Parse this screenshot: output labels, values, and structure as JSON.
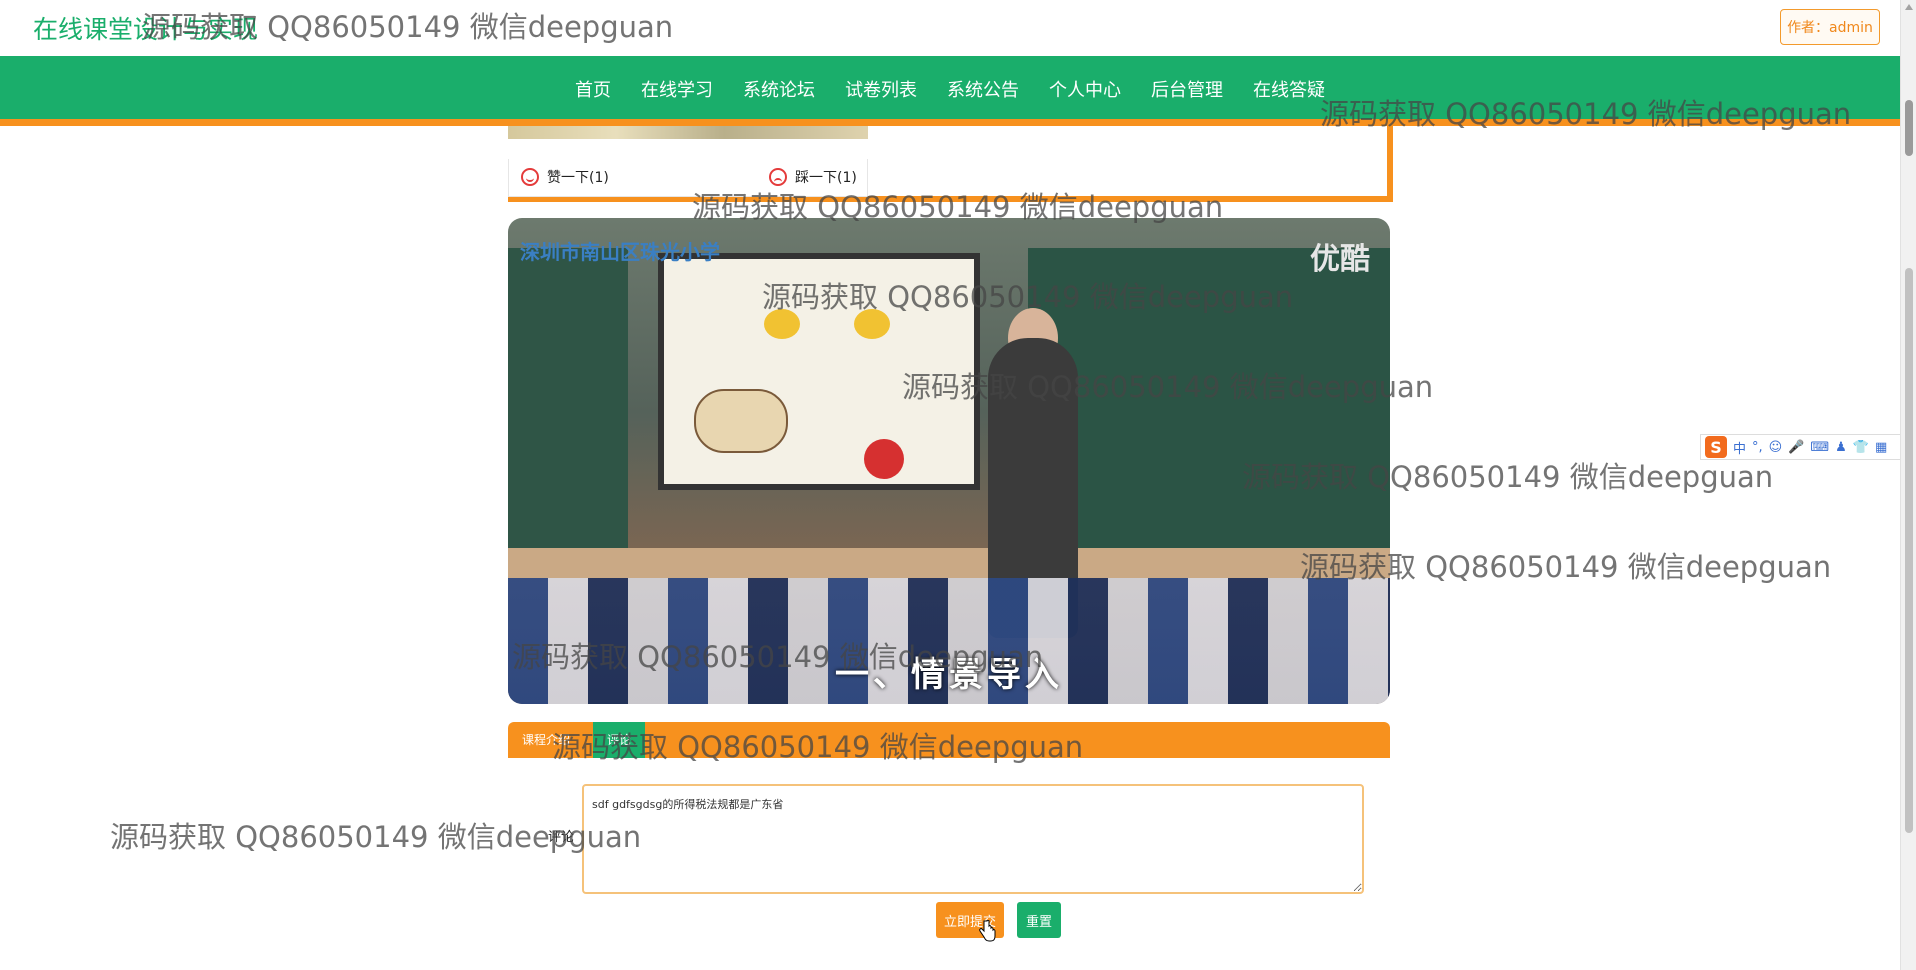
{
  "header": {
    "site_title": "在线课堂设计与实现",
    "author_badge": "作者：admin"
  },
  "nav": {
    "items": [
      "首页",
      "在线学习",
      "系统论坛",
      "试卷列表",
      "系统公告",
      "个人中心",
      "后台管理",
      "在线答疑"
    ]
  },
  "likes": {
    "like_label": "赞一下(1)",
    "dislike_label": "踩一下(1)"
  },
  "video": {
    "school_logo": "深圳市南山区珠光小学",
    "brand": "优酷",
    "caption": "一、情景导入"
  },
  "tabs": [
    {
      "label": "课程介绍",
      "active": false
    },
    {
      "label": "评论",
      "active": true
    }
  ],
  "comment": {
    "label": "评论",
    "value": "sdf gdfsgdsg的所得税法规都是广东省"
  },
  "buttons": {
    "submit": "立即提交",
    "reset": "重置"
  },
  "ime": {
    "logo": "S",
    "mode": "中"
  },
  "watermark": "源码获取 QQ86050149 微信deepguan",
  "colors": {
    "primary_green": "#1aae6b",
    "accent_orange": "#f7911e"
  }
}
